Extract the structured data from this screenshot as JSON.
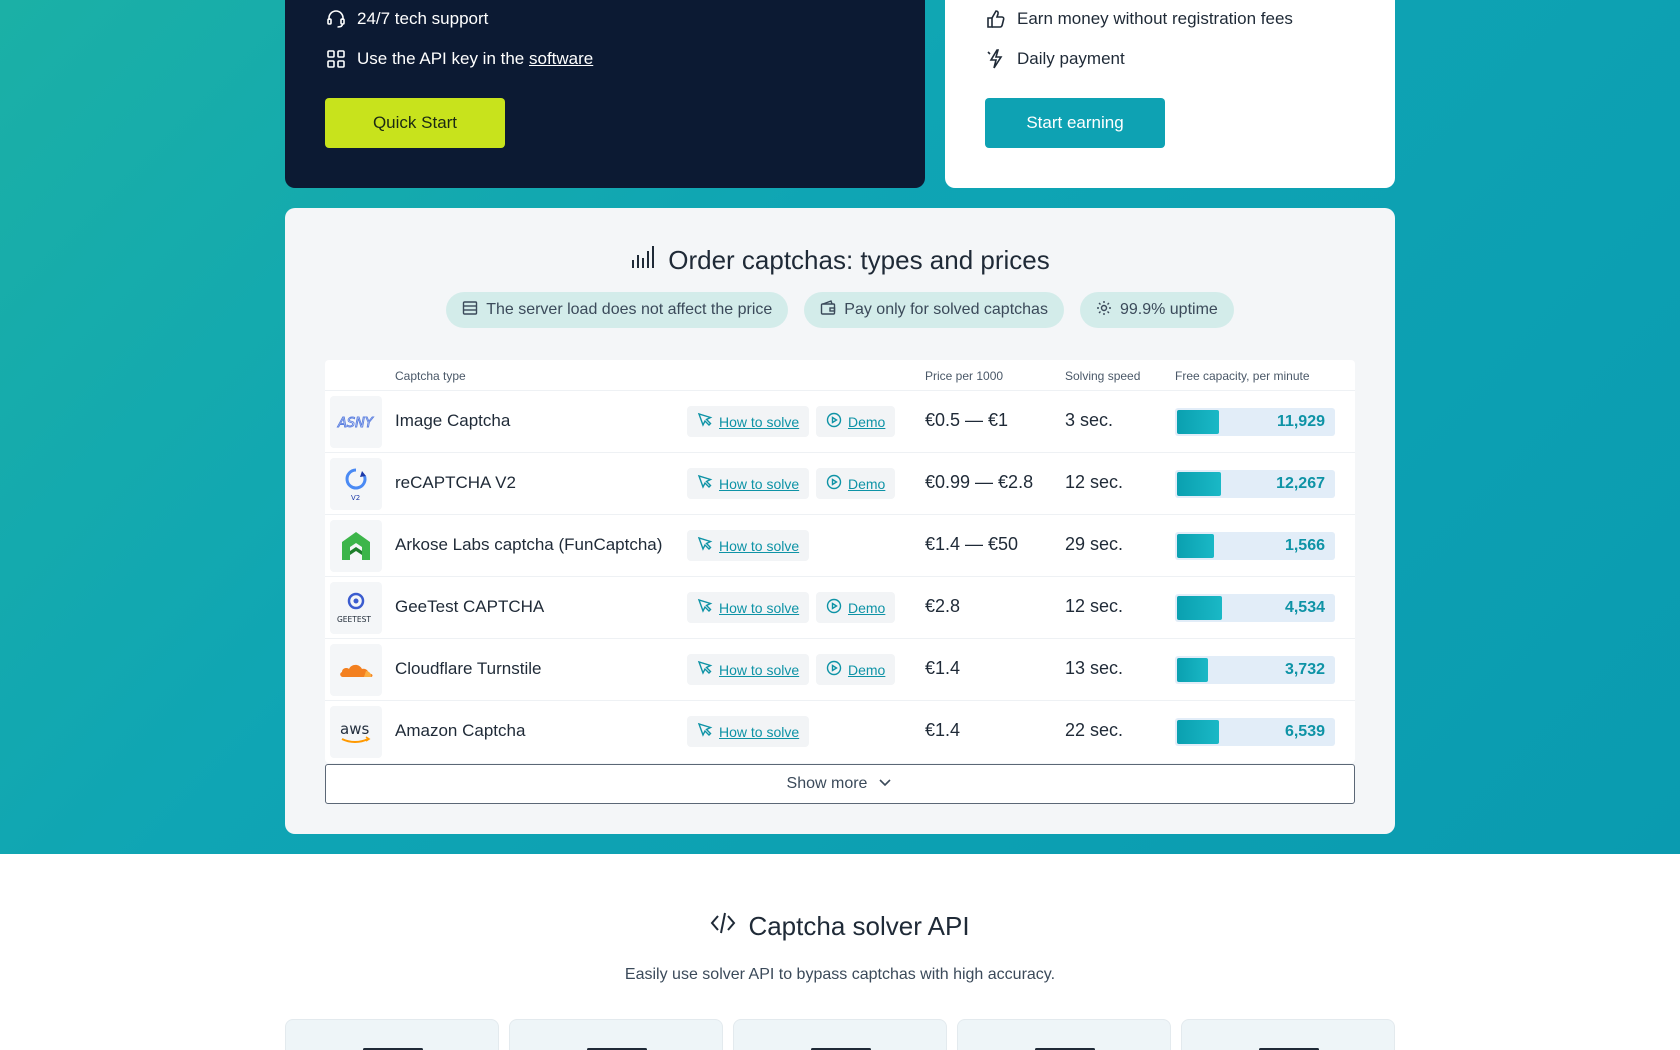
{
  "dev_card": {
    "feature_support": "24/7 tech support",
    "feature_api_prefix": "Use the API key in the",
    "feature_api_link": "software",
    "cta": "Quick Start"
  },
  "worker_card": {
    "feature_earn": "Earn money without registration fees",
    "feature_daily": "Daily payment",
    "cta": "Start earning"
  },
  "prices": {
    "title": "Order captchas: types and prices",
    "chips": [
      "The server load does not affect the price",
      "Pay only for solved captchas",
      "99.9% uptime"
    ],
    "headers": {
      "type": "Captcha type",
      "price": "Price per 1000",
      "speed": "Solving speed",
      "capacity": "Free capacity, per minute"
    },
    "how_label": "How to solve",
    "demo_label": "Demo",
    "rows": [
      {
        "name": "Image Captcha",
        "price": "€0.5 — €1",
        "speed": "3 sec.",
        "capacity": "11,929",
        "capacity_level": 0.27,
        "demo": true,
        "logo_text": "ASNY"
      },
      {
        "name": "reCAPTCHA V2",
        "price": "€0.99 — €2.8",
        "speed": "12 sec.",
        "capacity": "12,267",
        "capacity_level": 0.28,
        "demo": true,
        "logo_text": "V2"
      },
      {
        "name": "Arkose Labs captcha (FunCaptcha)",
        "price": "€1.4 — €50",
        "speed": "29 sec.",
        "capacity": "1,566",
        "capacity_level": 0.24,
        "demo": false,
        "logo_text": ""
      },
      {
        "name": "GeeTest CAPTCHA",
        "price": "€2.8",
        "speed": "12 sec.",
        "capacity": "4,534",
        "capacity_level": 0.29,
        "demo": true,
        "logo_text": "GEETEST"
      },
      {
        "name": "Cloudflare Turnstile",
        "price": "€1.4",
        "speed": "13 sec.",
        "capacity": "3,732",
        "capacity_level": 0.2,
        "demo": true,
        "logo_text": ""
      },
      {
        "name": "Amazon Captcha",
        "price": "€1.4",
        "speed": "22 sec.",
        "capacity": "6,539",
        "capacity_level": 0.27,
        "demo": false,
        "logo_text": "aws"
      }
    ],
    "show_more": "Show more"
  },
  "api_section": {
    "title": "Captcha solver API",
    "subtitle": "Easily use solver API to bypass captchas with high accuracy."
  },
  "colors": {
    "accent": "#0ea2b3",
    "lime": "#c8e31c",
    "dark": "#0c1a33"
  }
}
